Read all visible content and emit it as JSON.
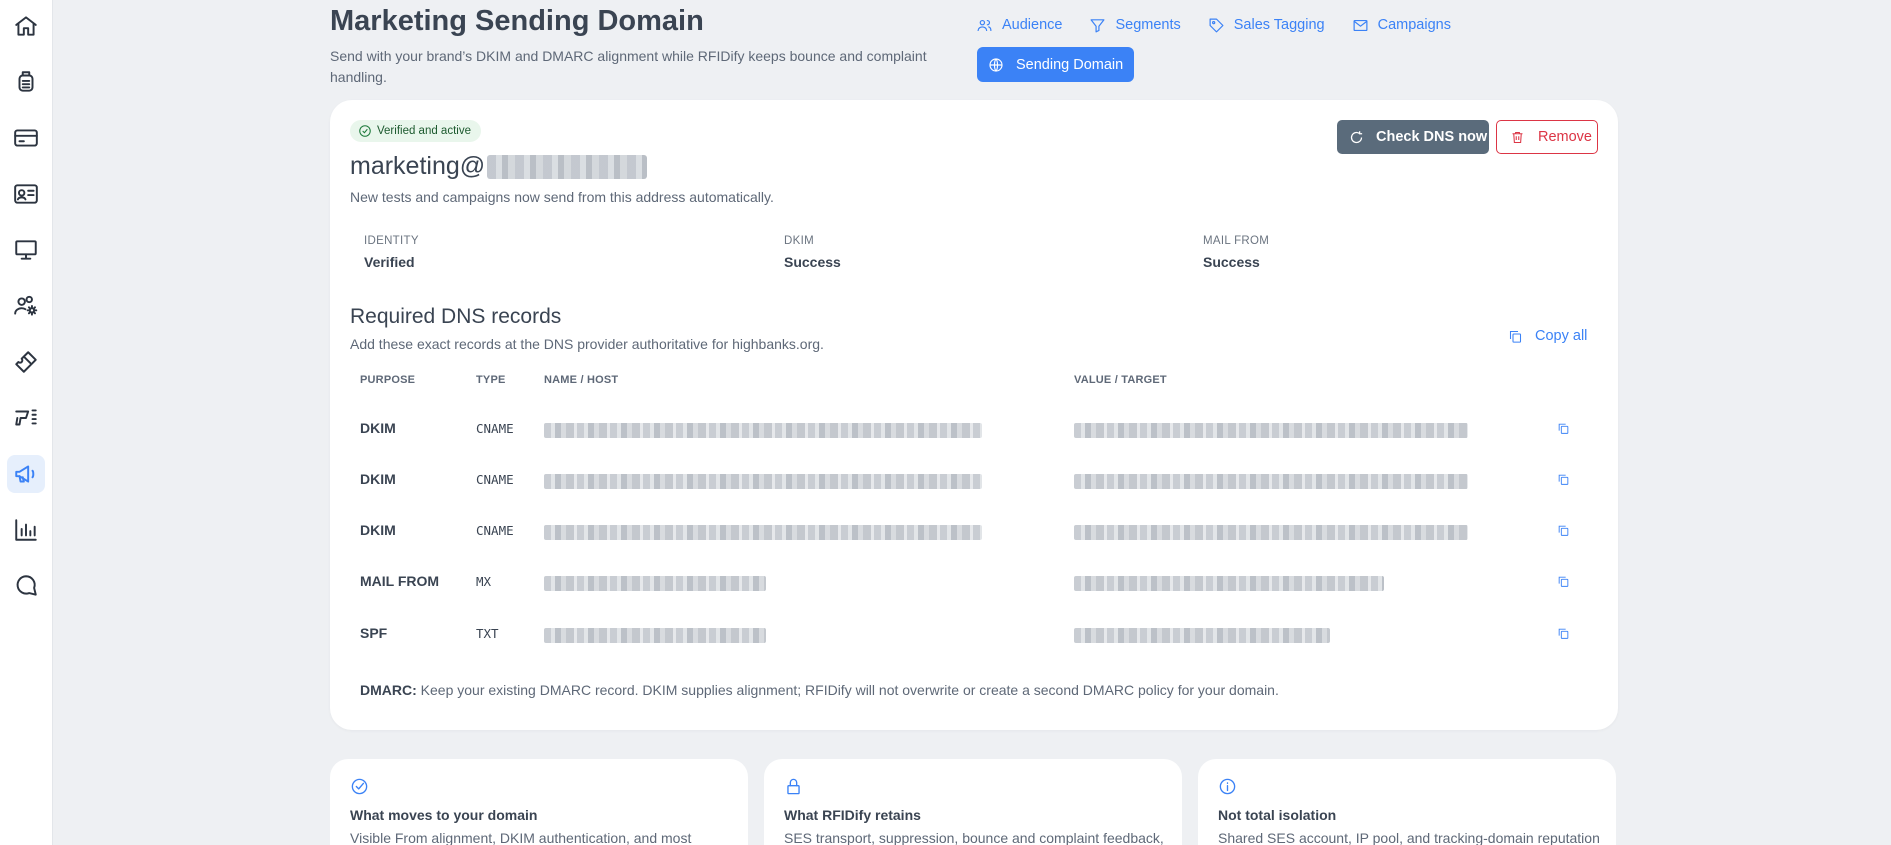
{
  "sidebar": {
    "items": [
      "home-icon",
      "scanner-icon",
      "card-icon",
      "id-card-icon",
      "monitor-icon",
      "users-settings-icon",
      "ticket-icon",
      "rfid-reader-icon",
      "megaphone-icon",
      "bar-chart-icon",
      "chat-icon"
    ],
    "active": "megaphone-icon"
  },
  "header": {
    "title": "Marketing Sending Domain",
    "subtitle": "Send with your brand’s DKIM and DMARC alignment while RFIDify keeps bounce and complaint handling."
  },
  "nav": {
    "audience": "Audience",
    "segments": "Segments",
    "sales_tagging": "Sales Tagging",
    "campaigns": "Campaigns",
    "sending_domain": "Sending Domain"
  },
  "domain_card": {
    "badge": "Verified and active",
    "email_prefix": "marketing@",
    "email_note": "New tests and campaigns now send from this address automatically.",
    "check_dns": "Check DNS now",
    "remove": "Remove",
    "stats": [
      {
        "label": "IDENTITY",
        "value": "Verified"
      },
      {
        "label": "DKIM",
        "value": "Success"
      },
      {
        "label": "MAIL FROM",
        "value": "Success"
      }
    ]
  },
  "dns": {
    "title": "Required DNS records",
    "subtitle": "Add these exact records at the DNS provider authoritative for highbanks.org.",
    "copy_all": "Copy all",
    "headers": {
      "purpose": "PURPOSE",
      "type": "TYPE",
      "name": "NAME / HOST",
      "value": "VALUE / TARGET"
    },
    "rows": [
      {
        "purpose": "DKIM",
        "type": "CNAME"
      },
      {
        "purpose": "DKIM",
        "type": "CNAME"
      },
      {
        "purpose": "DKIM",
        "type": "CNAME"
      },
      {
        "purpose": "MAIL FROM",
        "type": "MX"
      },
      {
        "purpose": "SPF",
        "type": "TXT"
      }
    ],
    "dmarc_label": "DMARC:",
    "dmarc_text": " Keep your existing DMARC record. DKIM supplies alignment; RFIDify will not overwrite or create a second DMARC policy for your domain."
  },
  "info_cards": [
    {
      "icon": "check-circle-icon",
      "title": "What moves to your domain",
      "text": "Visible From alignment, DKIM authentication, and most"
    },
    {
      "icon": "lock-icon",
      "title": "What RFIDify retains",
      "text": "SES transport, suppression, bounce and complaint feedback,"
    },
    {
      "icon": "info-icon",
      "title": "Not total isolation",
      "text": "Shared SES account, IP pool, and tracking-domain reputation"
    }
  ]
}
